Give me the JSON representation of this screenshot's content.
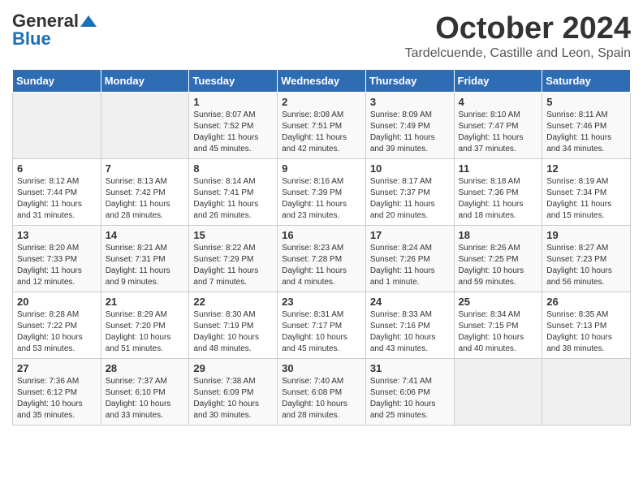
{
  "logo": {
    "general": "General",
    "blue": "Blue"
  },
  "title": "October 2024",
  "location": "Tardelcuende, Castille and Leon, Spain",
  "days_header": [
    "Sunday",
    "Monday",
    "Tuesday",
    "Wednesday",
    "Thursday",
    "Friday",
    "Saturday"
  ],
  "weeks": [
    [
      {
        "num": "",
        "info": ""
      },
      {
        "num": "",
        "info": ""
      },
      {
        "num": "1",
        "info": "Sunrise: 8:07 AM\nSunset: 7:52 PM\nDaylight: 11 hours and 45 minutes."
      },
      {
        "num": "2",
        "info": "Sunrise: 8:08 AM\nSunset: 7:51 PM\nDaylight: 11 hours and 42 minutes."
      },
      {
        "num": "3",
        "info": "Sunrise: 8:09 AM\nSunset: 7:49 PM\nDaylight: 11 hours and 39 minutes."
      },
      {
        "num": "4",
        "info": "Sunrise: 8:10 AM\nSunset: 7:47 PM\nDaylight: 11 hours and 37 minutes."
      },
      {
        "num": "5",
        "info": "Sunrise: 8:11 AM\nSunset: 7:46 PM\nDaylight: 11 hours and 34 minutes."
      }
    ],
    [
      {
        "num": "6",
        "info": "Sunrise: 8:12 AM\nSunset: 7:44 PM\nDaylight: 11 hours and 31 minutes."
      },
      {
        "num": "7",
        "info": "Sunrise: 8:13 AM\nSunset: 7:42 PM\nDaylight: 11 hours and 28 minutes."
      },
      {
        "num": "8",
        "info": "Sunrise: 8:14 AM\nSunset: 7:41 PM\nDaylight: 11 hours and 26 minutes."
      },
      {
        "num": "9",
        "info": "Sunrise: 8:16 AM\nSunset: 7:39 PM\nDaylight: 11 hours and 23 minutes."
      },
      {
        "num": "10",
        "info": "Sunrise: 8:17 AM\nSunset: 7:37 PM\nDaylight: 11 hours and 20 minutes."
      },
      {
        "num": "11",
        "info": "Sunrise: 8:18 AM\nSunset: 7:36 PM\nDaylight: 11 hours and 18 minutes."
      },
      {
        "num": "12",
        "info": "Sunrise: 8:19 AM\nSunset: 7:34 PM\nDaylight: 11 hours and 15 minutes."
      }
    ],
    [
      {
        "num": "13",
        "info": "Sunrise: 8:20 AM\nSunset: 7:33 PM\nDaylight: 11 hours and 12 minutes."
      },
      {
        "num": "14",
        "info": "Sunrise: 8:21 AM\nSunset: 7:31 PM\nDaylight: 11 hours and 9 minutes."
      },
      {
        "num": "15",
        "info": "Sunrise: 8:22 AM\nSunset: 7:29 PM\nDaylight: 11 hours and 7 minutes."
      },
      {
        "num": "16",
        "info": "Sunrise: 8:23 AM\nSunset: 7:28 PM\nDaylight: 11 hours and 4 minutes."
      },
      {
        "num": "17",
        "info": "Sunrise: 8:24 AM\nSunset: 7:26 PM\nDaylight: 11 hours and 1 minute."
      },
      {
        "num": "18",
        "info": "Sunrise: 8:26 AM\nSunset: 7:25 PM\nDaylight: 10 hours and 59 minutes."
      },
      {
        "num": "19",
        "info": "Sunrise: 8:27 AM\nSunset: 7:23 PM\nDaylight: 10 hours and 56 minutes."
      }
    ],
    [
      {
        "num": "20",
        "info": "Sunrise: 8:28 AM\nSunset: 7:22 PM\nDaylight: 10 hours and 53 minutes."
      },
      {
        "num": "21",
        "info": "Sunrise: 8:29 AM\nSunset: 7:20 PM\nDaylight: 10 hours and 51 minutes."
      },
      {
        "num": "22",
        "info": "Sunrise: 8:30 AM\nSunset: 7:19 PM\nDaylight: 10 hours and 48 minutes."
      },
      {
        "num": "23",
        "info": "Sunrise: 8:31 AM\nSunset: 7:17 PM\nDaylight: 10 hours and 45 minutes."
      },
      {
        "num": "24",
        "info": "Sunrise: 8:33 AM\nSunset: 7:16 PM\nDaylight: 10 hours and 43 minutes."
      },
      {
        "num": "25",
        "info": "Sunrise: 8:34 AM\nSunset: 7:15 PM\nDaylight: 10 hours and 40 minutes."
      },
      {
        "num": "26",
        "info": "Sunrise: 8:35 AM\nSunset: 7:13 PM\nDaylight: 10 hours and 38 minutes."
      }
    ],
    [
      {
        "num": "27",
        "info": "Sunrise: 7:36 AM\nSunset: 6:12 PM\nDaylight: 10 hours and 35 minutes."
      },
      {
        "num": "28",
        "info": "Sunrise: 7:37 AM\nSunset: 6:10 PM\nDaylight: 10 hours and 33 minutes."
      },
      {
        "num": "29",
        "info": "Sunrise: 7:38 AM\nSunset: 6:09 PM\nDaylight: 10 hours and 30 minutes."
      },
      {
        "num": "30",
        "info": "Sunrise: 7:40 AM\nSunset: 6:08 PM\nDaylight: 10 hours and 28 minutes."
      },
      {
        "num": "31",
        "info": "Sunrise: 7:41 AM\nSunset: 6:06 PM\nDaylight: 10 hours and 25 minutes."
      },
      {
        "num": "",
        "info": ""
      },
      {
        "num": "",
        "info": ""
      }
    ]
  ]
}
